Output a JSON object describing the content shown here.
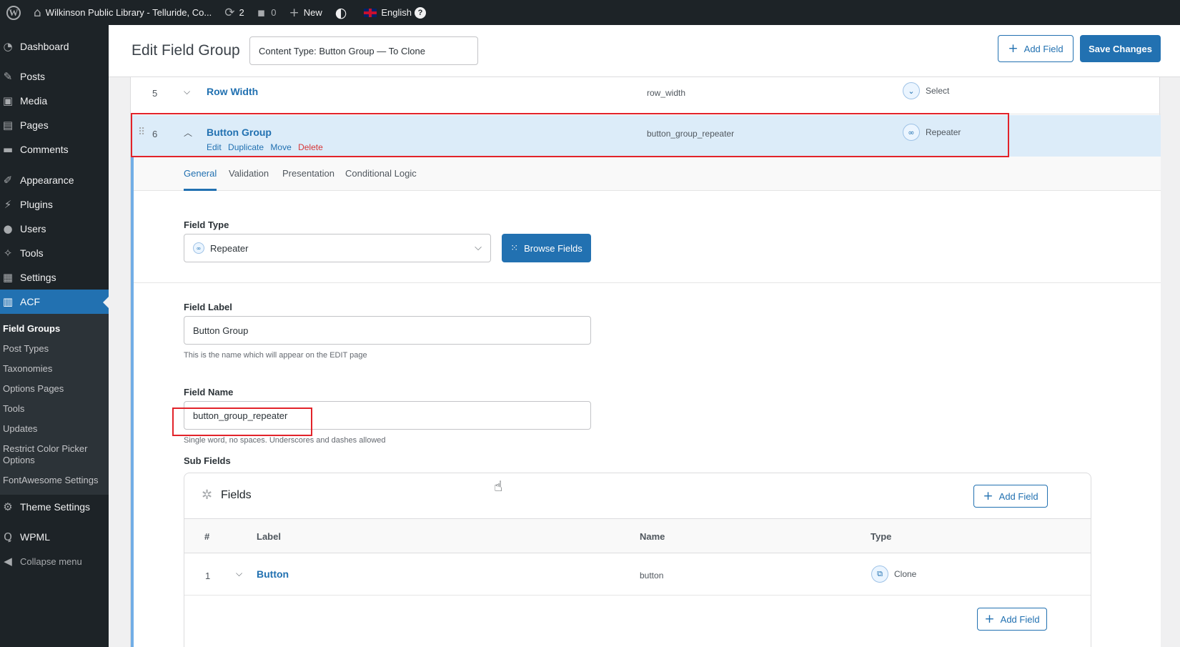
{
  "adminbar": {
    "site_name": "Wilkinson Public Library - Telluride, Co...",
    "updates_count": "2",
    "comments_count": "0",
    "new_label": "New",
    "language": "English",
    "help": "?"
  },
  "sidebar": {
    "items": [
      {
        "label": "Dashboard",
        "icon": "dashboard-icon"
      },
      {
        "label": "Posts",
        "icon": "pin-icon"
      },
      {
        "label": "Media",
        "icon": "media-icon"
      },
      {
        "label": "Pages",
        "icon": "pages-icon"
      },
      {
        "label": "Comments",
        "icon": "comment-icon"
      },
      {
        "label": "Appearance",
        "icon": "brush-icon"
      },
      {
        "label": "Plugins",
        "icon": "plugin-icon"
      },
      {
        "label": "Users",
        "icon": "user-icon"
      },
      {
        "label": "Tools",
        "icon": "wrench-icon"
      },
      {
        "label": "Settings",
        "icon": "settings-icon"
      },
      {
        "label": "ACF",
        "icon": "acf-icon"
      }
    ],
    "acf_sub": [
      "Field Groups",
      "Post Types",
      "Taxonomies",
      "Options Pages",
      "Tools",
      "Updates",
      "Restrict Color Picker Options",
      "FontAwesome Settings"
    ],
    "theme_settings": "Theme Settings",
    "wpml": "WPML",
    "collapse": "Collapse menu"
  },
  "header": {
    "title": "Edit Field Group",
    "group_title": "Content Type: Button Group — To Clone",
    "add_field": "Add Field",
    "save": "Save Changes"
  },
  "fields": [
    {
      "num": "5",
      "label": "Row Width",
      "name": "row_width",
      "type": "Select"
    },
    {
      "num": "6",
      "label": "Button Group",
      "name": "button_group_repeater",
      "type": "Repeater"
    }
  ],
  "row_actions": {
    "edit": "Edit",
    "duplicate": "Duplicate",
    "move": "Move",
    "delete": "Delete"
  },
  "tabs": [
    "General",
    "Validation",
    "Presentation",
    "Conditional Logic"
  ],
  "field_type": {
    "label": "Field Type",
    "value": "Repeater",
    "browse": "Browse Fields"
  },
  "field_label": {
    "label": "Field Label",
    "value": "Button Group",
    "help": "This is the name which will appear on the EDIT page"
  },
  "field_name": {
    "label": "Field Name",
    "value": "button_group_repeater",
    "help": "Single word, no spaces. Underscores and dashes allowed"
  },
  "subfields": {
    "label": "Sub Fields",
    "heading": "Fields",
    "add_field": "Add Field",
    "columns": {
      "num": "#",
      "label": "Label",
      "name": "Name",
      "type": "Type"
    },
    "rows": [
      {
        "num": "1",
        "label": "Button",
        "name": "button",
        "type": "Clone"
      }
    ],
    "add_field_bottom": "Add Field"
  },
  "colors": {
    "accent": "#2271b1",
    "admin_dark": "#1d2327",
    "highlight": "#e2232a",
    "selected_row": "#dcecf9"
  }
}
